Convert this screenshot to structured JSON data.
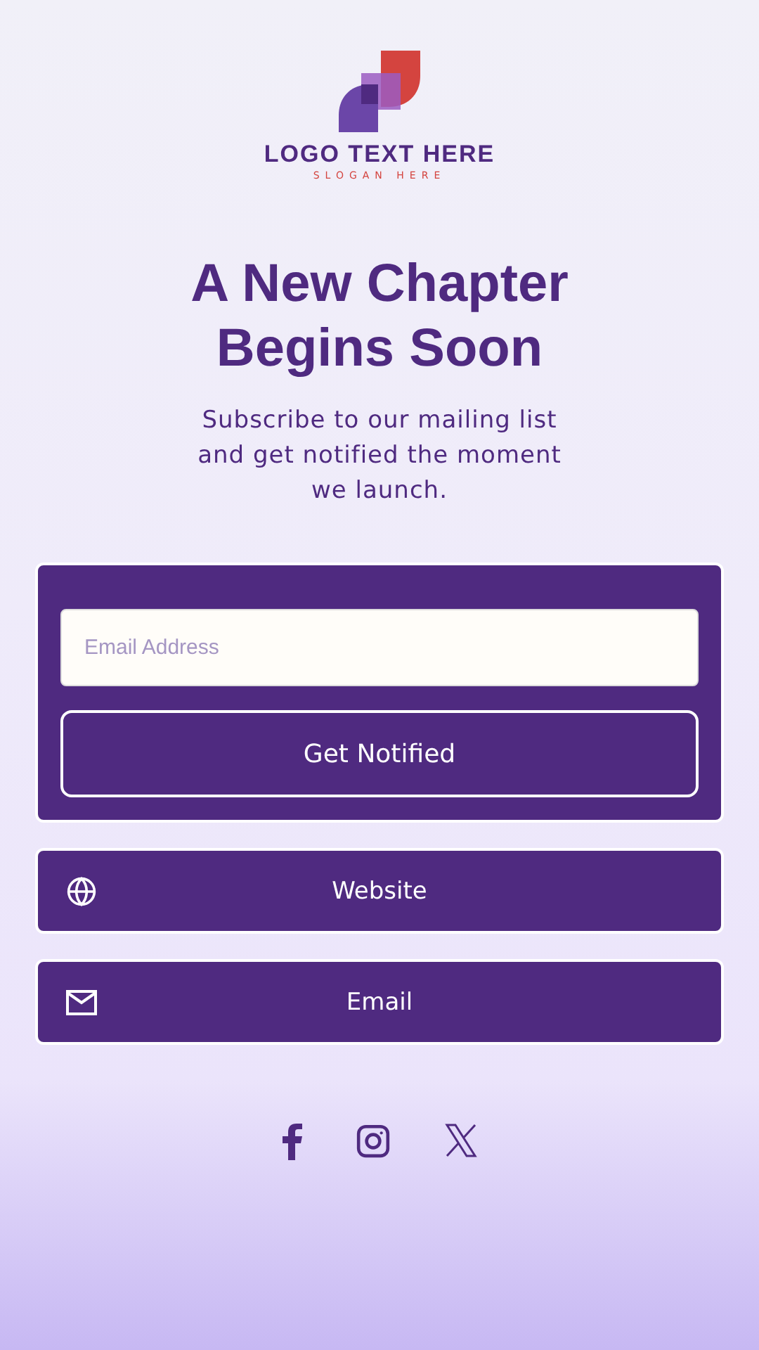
{
  "logo": {
    "name": "LOGO TEXT HERE",
    "slogan": "SLOGAN HERE"
  },
  "heading": "A New Chapter Begins Soon",
  "subtitle": "Subscribe to our mailing list and get notified the moment we launch.",
  "form": {
    "placeholder": "Email Address",
    "button": "Get Notified"
  },
  "links": [
    {
      "kind": "website",
      "label": "Website"
    },
    {
      "kind": "email",
      "label": "Email"
    }
  ],
  "social": [
    {
      "kind": "facebook"
    },
    {
      "kind": "instagram"
    },
    {
      "kind": "x"
    }
  ]
}
